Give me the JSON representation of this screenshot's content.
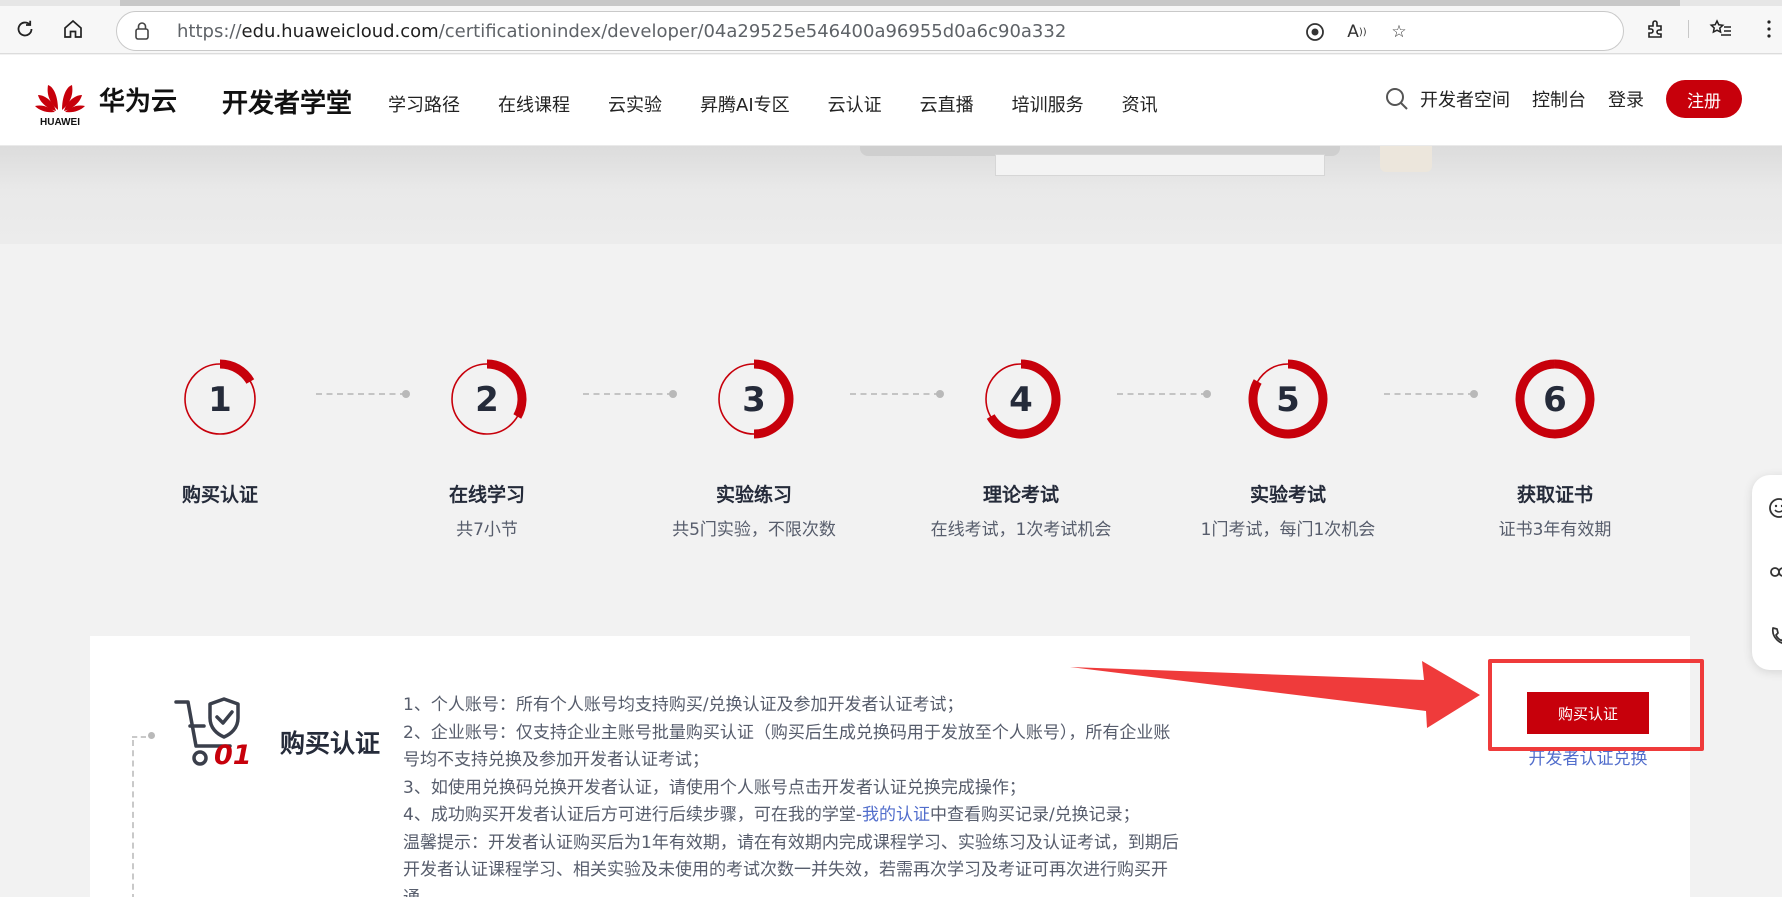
{
  "browser": {
    "url_prefix": "https://",
    "url_domain": "edu.huaweicloud.com",
    "url_path": "/certificationindex/developer/04a29525e546400a96955d0a6c90a332"
  },
  "header": {
    "brand_logo_text": "HUAWEI",
    "brand": "华为云",
    "site_title": "开发者学堂",
    "nav": [
      "学习路径",
      "在线课程",
      "云实验",
      "昇腾AI专区",
      "云认证",
      "云直播",
      "培训服务",
      "资讯"
    ],
    "right_links": [
      "开发者空间",
      "控制台",
      "登录"
    ],
    "register_label": "注册"
  },
  "steps": [
    {
      "num": "1",
      "title": "购买认证",
      "subtitle": "",
      "progress": 0.1667
    },
    {
      "num": "2",
      "title": "在线学习",
      "subtitle": "共7小节",
      "progress": 0.3333
    },
    {
      "num": "3",
      "title": "实验练习",
      "subtitle": "共5门实验，不限次数",
      "progress": 0.5
    },
    {
      "num": "4",
      "title": "理论考试",
      "subtitle": "在线考试，1次考试机会",
      "progress": 0.6667
    },
    {
      "num": "5",
      "title": "实验考试",
      "subtitle": "1门考试，每门1次机会",
      "progress": 0.8333
    },
    {
      "num": "6",
      "title": "获取证书",
      "subtitle": "证书3年有效期",
      "progress": 1.0
    }
  ],
  "card": {
    "icon_number": "01",
    "title": "购买认证",
    "lines": [
      "1、个人账号：所有个人账号均支持购买/兑换认证及参加开发者认证考试；",
      "2、企业账号：仅支持企业主账号批量购买认证（购买后生成兑换码用于发放至个人账号），所有企业账",
      "号均不支持兑换及参加开发者认证考试；",
      "3、如使用兑换码兑换开发者认证，请使用个人账号点击开发者认证兑换完成操作；"
    ],
    "line4_before": "4、成功购买开发者认证后方可进行后续步骤，可在我的学堂-",
    "line4_link": "我的认证",
    "line4_after": "中查看购买记录/兑换记录；",
    "tips": [
      "温馨提示：开发者认证购买后为1年有效期，请在有效期内完成课程学习、实验练习及认证考试，到期后",
      "开发者认证课程学习、相关实验及未使用的考试次数一并失效，若需再次学习及考证可再次进行购买开",
      "通。"
    ],
    "buy_button": "购买认证",
    "redeem_link": "开发者认证兑换"
  },
  "colors": {
    "brand_red": "#c7000b",
    "annotation_red": "#ef3b3b",
    "link_blue": "#526ecc"
  }
}
